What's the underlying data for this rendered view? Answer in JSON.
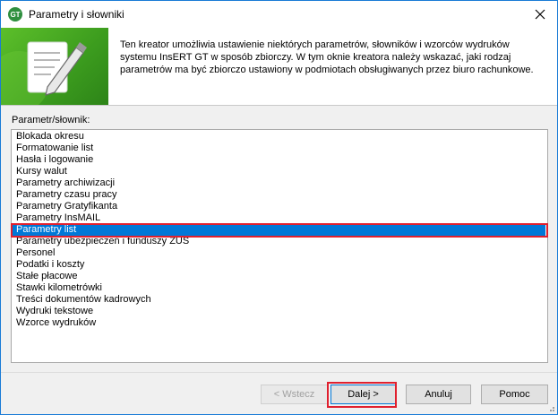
{
  "window": {
    "title": "Parametry i słowniki",
    "icon": "insert-gt-app-icon"
  },
  "header": {
    "banner_icon": "settings-edit-icon",
    "description": "Ten kreator umożliwia ustawienie niektórych parametrów, słowników i wzorców wydruków systemu InsERT GT w sposób zbiorczy. W tym oknie kreatora należy wskazać, jaki rodzaj parametrów ma być zbiorczo ustawiony w podmiotach obsługiwanych przez biuro rachunkowe."
  },
  "list": {
    "label": "Parametr/słownik:",
    "selected": "Parametry list",
    "items": [
      "Blokada okresu",
      "Formatowanie list",
      "Hasła i logowanie",
      "Kursy walut",
      "Parametry archiwizacji",
      "Parametry czasu pracy",
      "Parametry Gratyfikanta",
      "Parametry InsMAIL",
      "Parametry list",
      "Parametry ubezpieczeń i funduszy ZUS",
      "Personel",
      "Podatki i koszty",
      "Stałe płacowe",
      "Stawki kilometrówki",
      "Treści dokumentów kadrowych",
      "Wydruki tekstowe",
      "Wzorce wydruków"
    ]
  },
  "buttons": {
    "back": "< Wstecz",
    "next": "Dalej >",
    "cancel": "Anuluj",
    "help": "Pomoc"
  },
  "colors": {
    "selection": "#0078d7",
    "highlight_annotation": "#e0202e",
    "banner": "#4cae24"
  }
}
